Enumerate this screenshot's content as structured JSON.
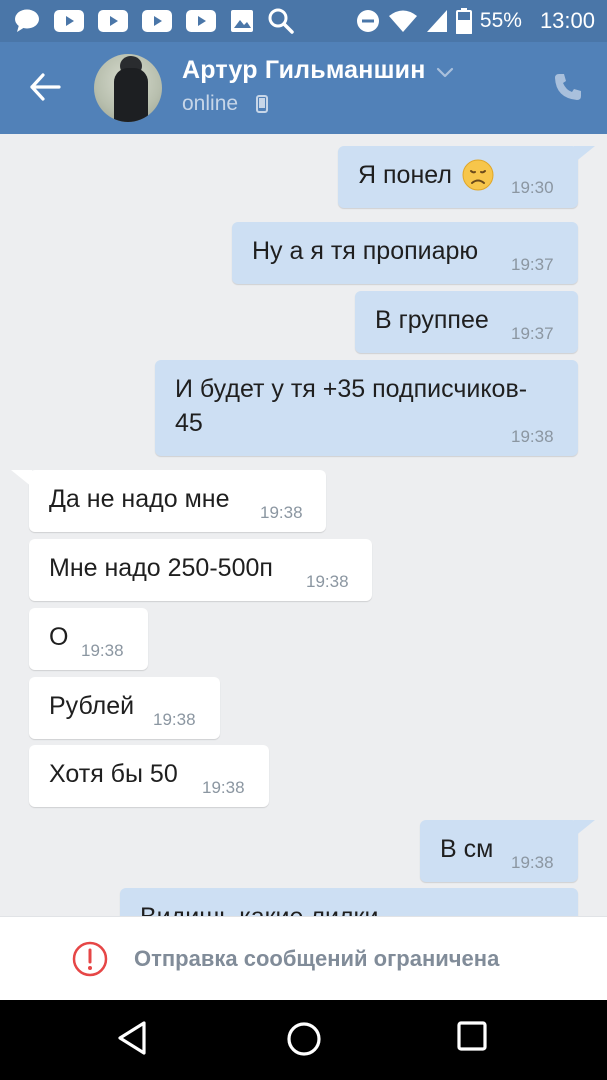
{
  "status_bar": {
    "battery_percent": "55%",
    "time": "13:00",
    "icons": [
      "chat-icon",
      "youtube-icon",
      "youtube-icon",
      "youtube-icon",
      "youtube-icon",
      "gallery-icon",
      "search-icon",
      "dnd-icon",
      "wifi-icon",
      "signal-icon",
      "battery-icon"
    ]
  },
  "header": {
    "contact_name": "Артур Гильманшин",
    "status": "online",
    "colors": {
      "bar": "#5181b8",
      "status_bar": "#4a76a8"
    }
  },
  "messages": [
    {
      "dir": "out",
      "text": "Я понел",
      "emoji": "disappointed-face",
      "time": "19:30"
    },
    {
      "dir": "out",
      "text": "Ну а я тя пропиарю",
      "time": "19:37"
    },
    {
      "dir": "out",
      "text": "В группее",
      "time": "19:37"
    },
    {
      "dir": "out",
      "line1": "И будет у тя +35 подписчиков-",
      "line2": "45",
      "time": "19:38"
    },
    {
      "dir": "in",
      "text": "Да не надо мне",
      "time": "19:38"
    },
    {
      "dir": "in",
      "text": "Мне надо 250-500п",
      "time": "19:38"
    },
    {
      "dir": "in",
      "text": "О",
      "time": "19:38"
    },
    {
      "dir": "in",
      "text": "Рублей",
      "time": "19:38"
    },
    {
      "dir": "in",
      "text": "Хотя бы 50",
      "time": "19:38"
    },
    {
      "dir": "out",
      "text": "В см",
      "time": "19:38"
    },
    {
      "dir": "out",
      "text": "Видишь какие лилки"
    }
  ],
  "restriction": {
    "text": "Отправка сообщений ограничена"
  },
  "nav": {
    "buttons": [
      "back-icon",
      "home-icon",
      "recents-icon"
    ]
  }
}
